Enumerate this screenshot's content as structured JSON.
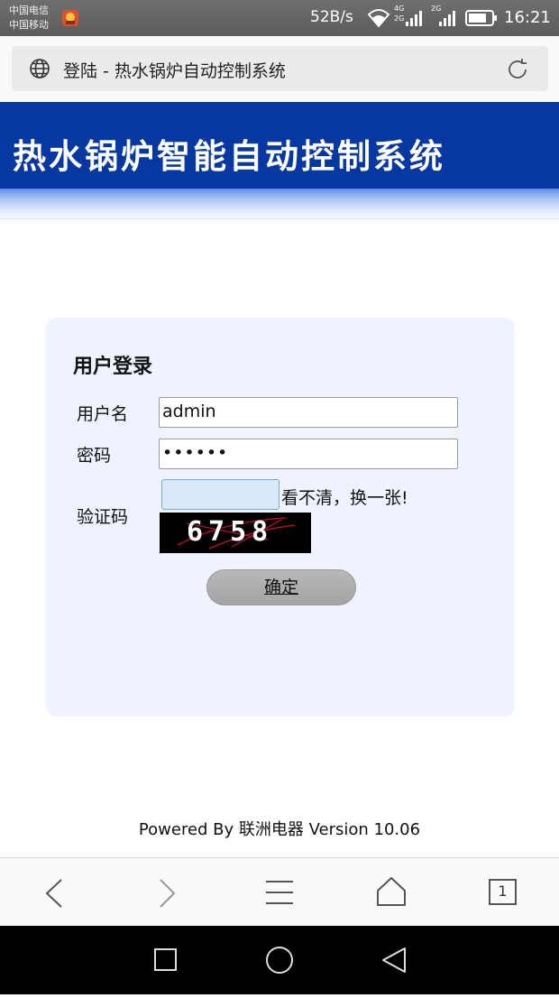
{
  "status_bar": {
    "carrier_1": "中国电信",
    "carrier_2": "中国移动",
    "net_speed": "52B/s",
    "network_1": "4G",
    "network_2": "2G",
    "network_3": "2G",
    "time": "16:21"
  },
  "browser": {
    "tab_title": "登陆 - 热水锅炉自动控制系统",
    "tab_count": "1"
  },
  "header": {
    "title": "热水锅炉智能自动控制系统"
  },
  "login": {
    "heading": "用户登录",
    "username_label": "用户名",
    "username_value": "admin",
    "password_label": "密码",
    "password_value": "••••••",
    "captcha_label": "验证码",
    "captcha_value": "",
    "captcha_refresh": "看不清，换一张!",
    "captcha_code": "6758",
    "submit_label": "确定"
  },
  "footer": {
    "text": "Powered By 联洲电器 Version 10.06"
  },
  "colors": {
    "header_blue": "#0738a2",
    "panel_bg": "#eef3fe"
  }
}
